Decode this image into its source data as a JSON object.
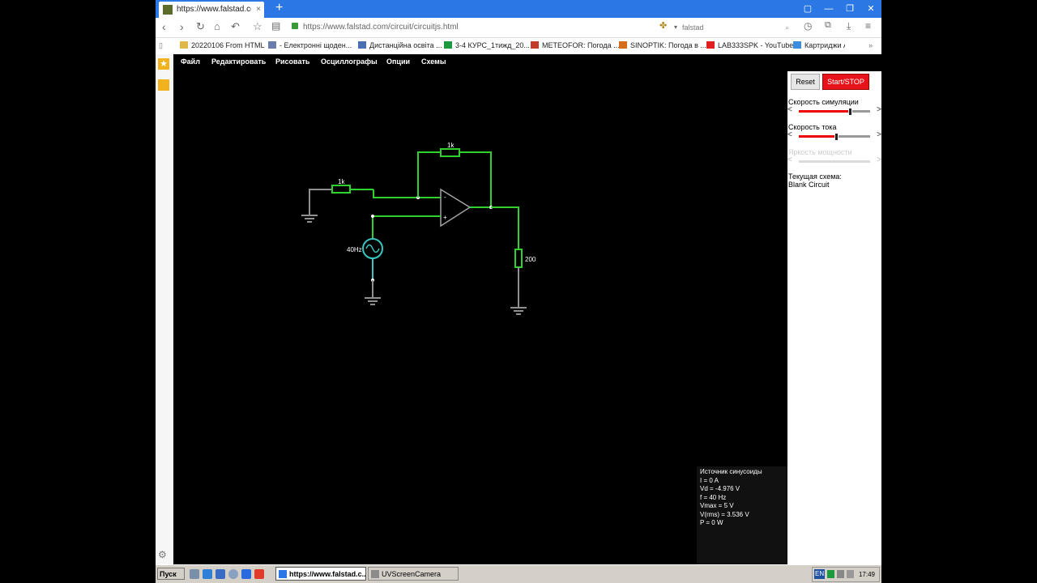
{
  "browser": {
    "tab_title": "https://www.falstad.com/c",
    "tab_close": "×",
    "new_tab": "+",
    "url": "https://www.falstad.com/circuit/circuitjs.html",
    "search_value": "falstad",
    "bookmarks": [
      "20220106 From HTML",
      "- Електронні щоден...",
      "Дистанційна освіта ...",
      "3-4 КУРС_1тижд_20...",
      "METEOFOR: Погода ...",
      "SINOPTIK: Погода в ...",
      "LAB333SPK - YouTube",
      "Картриджи А"
    ]
  },
  "app": {
    "menu": [
      "Файл",
      "Редактировать",
      "Рисовать",
      "Осциллографы",
      "Опции",
      "Схемы"
    ],
    "reset_label": "Reset",
    "start_label": "Start/STOP",
    "sim_speed_label": "Скорость симуляции",
    "current_speed_label": "Скорость тока",
    "power_brightness_label": "Яркость мощности",
    "current_circuit_label": "Текущая схема:",
    "current_circuit_name": "Blank Circuit",
    "sim_speed_level": 0.72,
    "current_speed_level": 0.52
  },
  "circuit": {
    "r_input_label": "1k",
    "r_feedback_label": "1k",
    "r_load_label": "200",
    "source_label": "40Hz",
    "opamp_minus": "-",
    "opamp_plus": "+",
    "colors": {
      "active": "#2fd12f",
      "inactive": "#909090",
      "source": "#3ac6c0"
    }
  },
  "info": [
    "Источник синусоиды",
    "I = 0 A",
    "Vd = -4.976 V",
    "f = 40 Hz",
    "Vmax = 5 V",
    "V(rms) = 3.536 V",
    "P = 0 W"
  ],
  "taskbar": {
    "start_label": "Пуск",
    "tasks": [
      "https://www.falstad.c...",
      "UVScreenCamera"
    ],
    "lang": "EN",
    "time": "17:49"
  }
}
